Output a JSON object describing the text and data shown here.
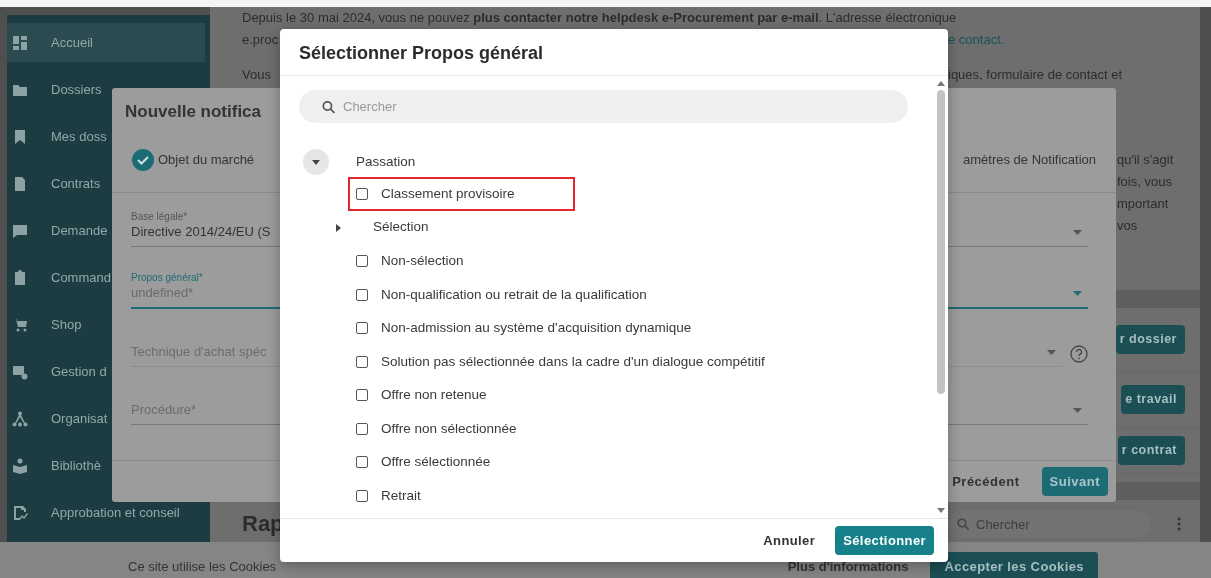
{
  "sidebar": {
    "items": [
      {
        "label": "Accueil",
        "selected": true
      },
      {
        "label": "Dossiers",
        "selected": false
      },
      {
        "label": "Mes doss",
        "selected": false
      },
      {
        "label": "Contrats",
        "selected": false
      },
      {
        "label": "Demande",
        "selected": false
      },
      {
        "label": "Command",
        "selected": false
      },
      {
        "label": "Shop",
        "selected": false
      },
      {
        "label": "Gestion d",
        "selected": false
      },
      {
        "label": "Organisat",
        "selected": false
      },
      {
        "label": "Bibliothè",
        "selected": false
      },
      {
        "label": "Approbation et conseil",
        "selected": false
      }
    ]
  },
  "notice": {
    "line_1": "Depuis le 30 mai 2024, vous ne pouvez **plus contacter notre helpdesk e-Procurement par e-mail**. L'adresse électronique",
    "line_2_start": "e.proc",
    "line_2_link": "e contact.",
    "line_3_start": "Vous",
    "line_3_end": "iques, formulaire de contact et",
    "side_lines": [
      "qu'il s'agit",
      "fois, vous",
      "mportant",
      "vos"
    ]
  },
  "action_buttons": [
    "r dossier",
    "e travail",
    "r contrat"
  ],
  "section": {
    "title": "Rap",
    "search": {
      "placeholder": "Chercher"
    }
  },
  "cookie_bar": {
    "text": "Ce site utilise les Cookies",
    "link": "Plus d'informations",
    "button": "Accepter les Cookies"
  },
  "notification_dialog": {
    "title": "Nouvelle notifica",
    "steps": [
      {
        "label": "Objet du marché",
        "done": true
      },
      {
        "label": "amètres de Notification"
      }
    ],
    "fields": [
      {
        "label": "Base légale*",
        "value": "Directive 2014/24/EU (S",
        "focused": false
      },
      {
        "label": "Propos général*",
        "placeholder": "undefined*",
        "focused": true
      },
      {
        "placeholder": "Technique d'achat spéc",
        "focused": false,
        "disabled": true,
        "help": true
      },
      {
        "placeholder": "Procédure*",
        "focused": false
      }
    ],
    "buttons": {
      "back": "Précédent",
      "next": "Suivant"
    }
  },
  "select_dialog": {
    "title": "Sélectionner Propos général",
    "search": {
      "placeholder": "Chercher"
    },
    "tree": [
      {
        "label": "Passation",
        "kind": "group",
        "expanded": true,
        "children": [
          {
            "label": "Classement provisoire",
            "kind": "checkbox",
            "checked": false,
            "highlighted": true
          },
          {
            "label": "Sélection",
            "kind": "group",
            "expanded": false,
            "highlighted": false
          },
          {
            "label": "Non-sélection",
            "kind": "checkbox",
            "checked": false,
            "highlighted": false
          },
          {
            "label": "Non-qualification ou retrait de la qualification",
            "kind": "checkbox",
            "checked": false,
            "highlighted": false
          },
          {
            "label": "Non-admission au système d'acquisition dynamique",
            "kind": "checkbox",
            "checked": false,
            "highlighted": false
          },
          {
            "label": "Solution pas sélectionnée dans la cadre d'un dialogue compétitif",
            "kind": "checkbox",
            "checked": false,
            "highlighted": false
          },
          {
            "label": "Offre non retenue",
            "kind": "checkbox",
            "checked": false,
            "highlighted": false
          },
          {
            "label": "Offre non sélectionnée",
            "kind": "checkbox",
            "checked": false,
            "highlighted": false
          },
          {
            "label": "Offre sélectionnée",
            "kind": "checkbox",
            "checked": false,
            "highlighted": false
          },
          {
            "label": "Retrait",
            "kind": "checkbox",
            "checked": false,
            "highlighted": false
          }
        ]
      }
    ],
    "buttons": {
      "cancel": "Annuler",
      "confirm": "Sélectionner"
    }
  }
}
